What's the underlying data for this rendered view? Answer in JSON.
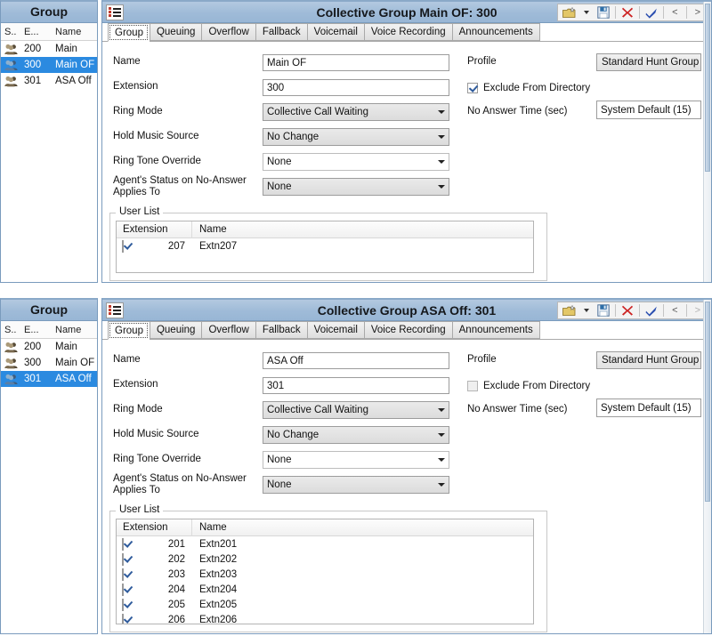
{
  "panels": [
    {
      "sidebar": {
        "title": "Group",
        "columns": [
          "S..",
          "E...",
          "Name"
        ],
        "rows": [
          {
            "icon": "group-icon",
            "extension": "200",
            "name": "Main",
            "selected": false
          },
          {
            "icon": "group-icon",
            "extension": "300",
            "name": "Main OF",
            "selected": true
          },
          {
            "icon": "group-icon",
            "extension": "301",
            "name": "ASA Off",
            "selected": false
          }
        ]
      },
      "title": "Collective Group Main OF: 300",
      "title_icon": "list-icon",
      "toolbar": {
        "new_icon": "new-folder-icon",
        "dropdown_icon": "chevron-down-icon",
        "save_icon": "save-disk-icon",
        "delete_icon": "red-x-icon",
        "ok_icon": "blue-check-icon",
        "prev_label": "<",
        "next_label": ">",
        "prev_disabled": false,
        "next_disabled": false
      },
      "tabs": [
        {
          "label": "Group",
          "active": true
        },
        {
          "label": "Queuing",
          "active": false
        },
        {
          "label": "Overflow",
          "active": false
        },
        {
          "label": "Fallback",
          "active": false
        },
        {
          "label": "Voicemail",
          "active": false
        },
        {
          "label": "Voice Recording",
          "active": false
        },
        {
          "label": "Announcements",
          "active": false
        }
      ],
      "fields": {
        "name_label": "Name",
        "name_value": "Main OF",
        "extension_label": "Extension",
        "extension_value": "300",
        "ring_mode_label": "Ring Mode",
        "ring_mode_value": "Collective Call Waiting",
        "hold_music_label": "Hold Music Source",
        "hold_music_value": "No Change",
        "ring_tone_label": "Ring Tone Override",
        "ring_tone_value": "None",
        "agent_status_label": "Agent's Status on No-Answer Applies To",
        "agent_status_value": "None",
        "profile_label": "Profile",
        "profile_value": "Standard Hunt Group",
        "exclude_label": "Exclude From Directory",
        "exclude_checked": true,
        "no_answer_label": "No Answer Time (sec)",
        "no_answer_value": "System Default (15)"
      },
      "user_list": {
        "legend": "User List",
        "columns": [
          "Extension",
          "Name"
        ],
        "rows": [
          {
            "checked": true,
            "extension": "207",
            "name": "Extn207"
          }
        ]
      }
    },
    {
      "sidebar": {
        "title": "Group",
        "columns": [
          "S..",
          "E...",
          "Name"
        ],
        "rows": [
          {
            "icon": "group-icon",
            "extension": "200",
            "name": "Main",
            "selected": false
          },
          {
            "icon": "group-icon",
            "extension": "300",
            "name": "Main OF",
            "selected": false
          },
          {
            "icon": "group-icon",
            "extension": "301",
            "name": "ASA Off",
            "selected": true
          }
        ]
      },
      "title": "Collective Group ASA Off: 301",
      "title_icon": "list-icon",
      "toolbar": {
        "new_icon": "new-folder-icon",
        "dropdown_icon": "chevron-down-icon",
        "save_icon": "save-disk-icon",
        "delete_icon": "red-x-icon",
        "ok_icon": "blue-check-icon",
        "prev_label": "<",
        "next_label": ">",
        "prev_disabled": false,
        "next_disabled": true
      },
      "tabs": [
        {
          "label": "Group",
          "active": true
        },
        {
          "label": "Queuing",
          "active": false
        },
        {
          "label": "Overflow",
          "active": false
        },
        {
          "label": "Fallback",
          "active": false
        },
        {
          "label": "Voicemail",
          "active": false
        },
        {
          "label": "Voice Recording",
          "active": false
        },
        {
          "label": "Announcements",
          "active": false
        }
      ],
      "fields": {
        "name_label": "Name",
        "name_value": "ASA Off",
        "extension_label": "Extension",
        "extension_value": "301",
        "ring_mode_label": "Ring Mode",
        "ring_mode_value": "Collective Call Waiting",
        "hold_music_label": "Hold Music Source",
        "hold_music_value": "No Change",
        "ring_tone_label": "Ring Tone Override",
        "ring_tone_value": "None",
        "agent_status_label": "Agent's Status on No-Answer Applies To",
        "agent_status_value": "None",
        "profile_label": "Profile",
        "profile_value": "Standard Hunt Group",
        "exclude_label": "Exclude From Directory",
        "exclude_checked": false,
        "no_answer_label": "No Answer Time (sec)",
        "no_answer_value": "System Default (15)"
      },
      "user_list": {
        "legend": "User List",
        "columns": [
          "Extension",
          "Name"
        ],
        "rows": [
          {
            "checked": true,
            "extension": "201",
            "name": "Extn201"
          },
          {
            "checked": true,
            "extension": "202",
            "name": "Extn202"
          },
          {
            "checked": true,
            "extension": "203",
            "name": "Extn203"
          },
          {
            "checked": true,
            "extension": "204",
            "name": "Extn204"
          },
          {
            "checked": true,
            "extension": "205",
            "name": "Extn205"
          },
          {
            "checked": true,
            "extension": "206",
            "name": "Extn206"
          }
        ]
      }
    }
  ],
  "colors": {
    "header_blue": "#9fbbd8",
    "selection_blue": "#2b8ae0",
    "border_blue": "#7a9bbd"
  }
}
